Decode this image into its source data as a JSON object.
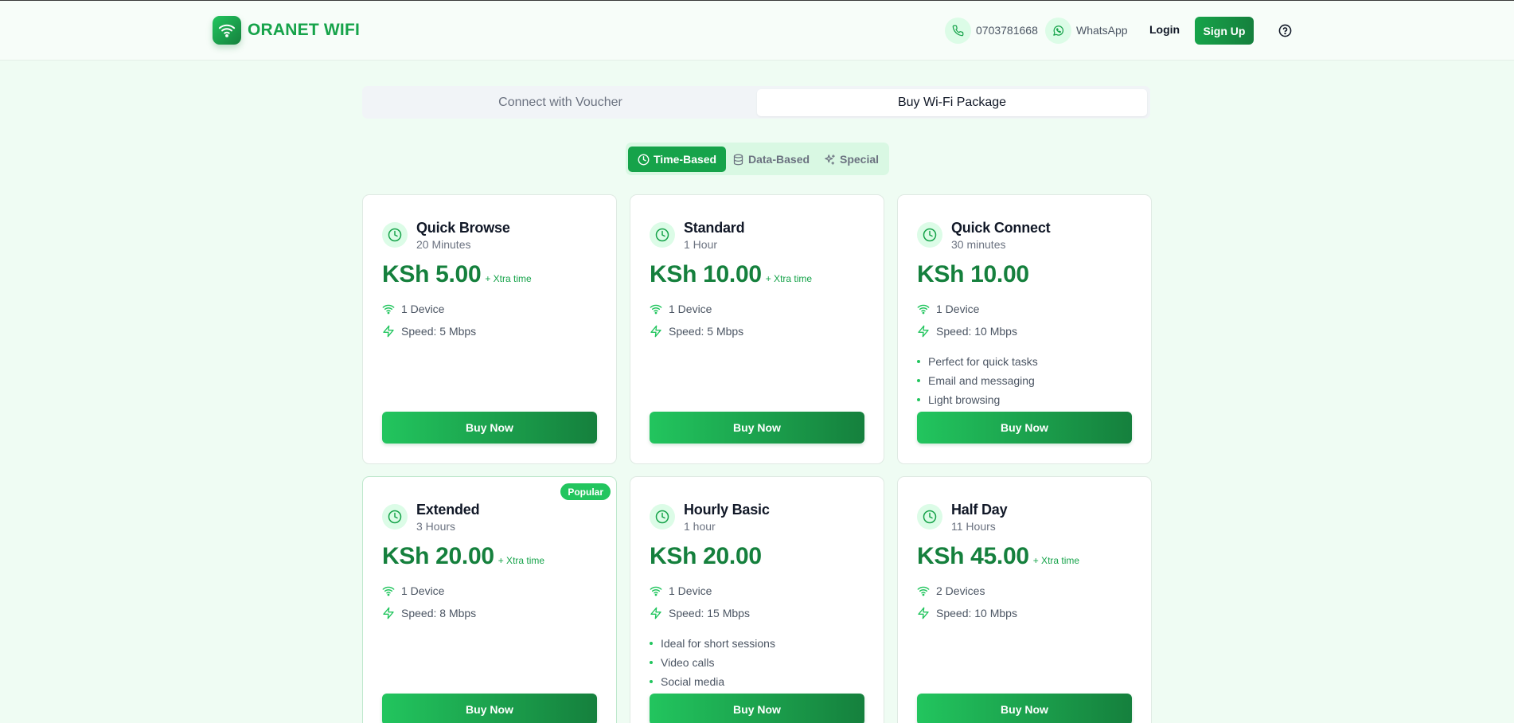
{
  "brand": {
    "name": "ORANET WIFI"
  },
  "header": {
    "phone": "0703781668",
    "whatsapp": "WhatsApp",
    "login": "Login",
    "signup": "Sign Up"
  },
  "main_tabs": [
    {
      "label": "Connect with Voucher",
      "active": false
    },
    {
      "label": "Buy Wi-Fi Package",
      "active": true
    }
  ],
  "sub_tabs": [
    {
      "label": "Time-Based",
      "icon": "clock-icon",
      "active": true
    },
    {
      "label": "Data-Based",
      "icon": "database-icon",
      "active": false
    },
    {
      "label": "Special",
      "icon": "sparkles-icon",
      "active": false
    }
  ],
  "colors": {
    "accent": "#16a34a",
    "accent_dark": "#15803d",
    "page_bg": "#effcf3"
  },
  "packages": [
    {
      "name": "Quick Browse",
      "duration": "20 Minutes",
      "price": "KSh 5.00",
      "extra": "+ Xtra time",
      "devices": "1 Device",
      "speed": "Speed: 5 Mbps",
      "bullets": [],
      "badge": "",
      "button": "Buy Now"
    },
    {
      "name": "Standard",
      "duration": "1 Hour",
      "price": "KSh 10.00",
      "extra": "+ Xtra time",
      "devices": "1 Device",
      "speed": "Speed: 5 Mbps",
      "bullets": [],
      "badge": "",
      "button": "Buy Now"
    },
    {
      "name": "Quick Connect",
      "duration": "30 minutes",
      "price": "KSh 10.00",
      "extra": "",
      "devices": "1 Device",
      "speed": "Speed: 10 Mbps",
      "bullets": [
        "Perfect for quick tasks",
        "Email and messaging",
        "Light browsing"
      ],
      "badge": "",
      "button": "Buy Now"
    },
    {
      "name": "Extended",
      "duration": "3 Hours",
      "price": "KSh 20.00",
      "extra": "+ Xtra time",
      "devices": "1 Device",
      "speed": "Speed: 8 Mbps",
      "bullets": [],
      "badge": "Popular",
      "button": "Buy Now"
    },
    {
      "name": "Hourly Basic",
      "duration": "1 hour",
      "price": "KSh 20.00",
      "extra": "",
      "devices": "1 Device",
      "speed": "Speed: 15 Mbps",
      "bullets": [
        "Ideal for short sessions",
        "Video calls",
        "Social media"
      ],
      "badge": "",
      "button": "Buy Now"
    },
    {
      "name": "Half Day",
      "duration": "11 Hours",
      "price": "KSh 45.00",
      "extra": "+ Xtra time",
      "devices": "2 Devices",
      "speed": "Speed: 10 Mbps",
      "bullets": [],
      "badge": "",
      "button": "Buy Now"
    }
  ]
}
